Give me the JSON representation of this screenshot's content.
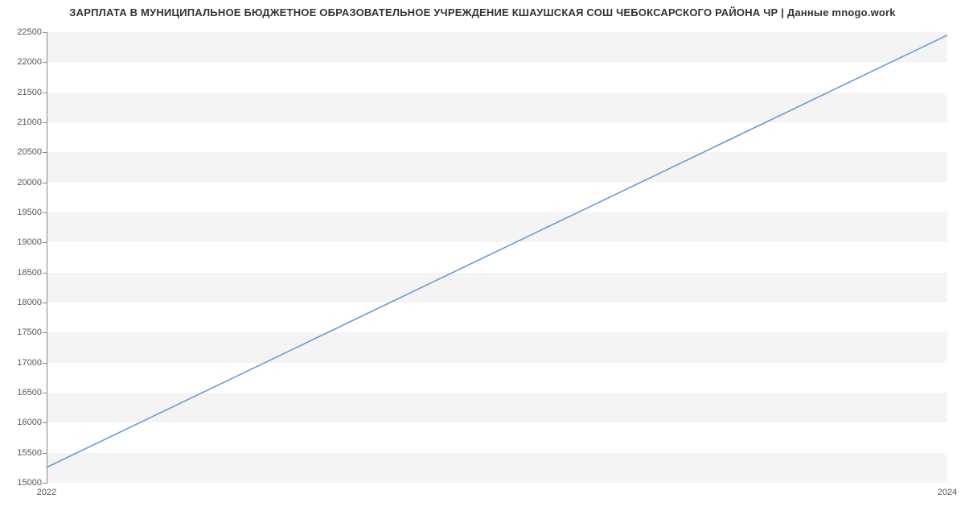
{
  "chart_data": {
    "type": "line",
    "title": "ЗАРПЛАТА В МУНИЦИПАЛЬНОЕ БЮДЖЕТНОЕ ОБРАЗОВАТЕЛЬНОЕ УЧРЕЖДЕНИЕ КШАУШСКАЯ СОШ ЧЕБОКСАРСКОГО РАЙОНА ЧР | Данные mnogo.work",
    "x": [
      2022,
      2024
    ],
    "values": [
      15250,
      22450
    ],
    "xlabel": "",
    "ylabel": "",
    "xlim": [
      2022,
      2024
    ],
    "ylim": [
      15000,
      22500
    ],
    "x_ticks": [
      2022,
      2024
    ],
    "y_ticks": [
      15000,
      15500,
      16000,
      16500,
      17000,
      17500,
      18000,
      18500,
      19000,
      19500,
      20000,
      20500,
      21000,
      21500,
      22000,
      22500
    ],
    "grid": "banded",
    "line_color": "#6b9bd1"
  }
}
